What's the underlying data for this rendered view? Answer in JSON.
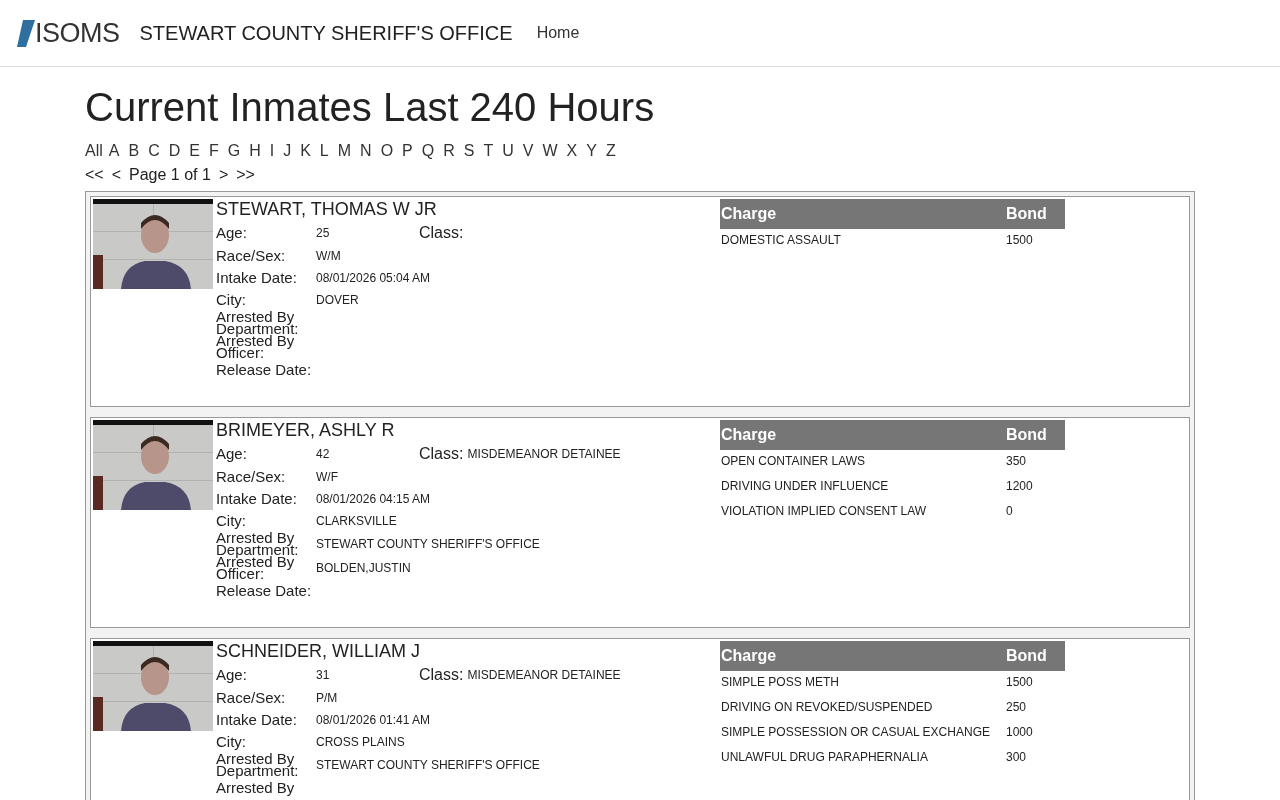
{
  "navbar": {
    "brand": "ISOMS",
    "title": "STEWART COUNTY SHERIFF'S OFFICE",
    "links": [
      "Home"
    ]
  },
  "heading": "Current Inmates Last 240 Hours",
  "letters": [
    "All",
    "A",
    "B",
    "C",
    "D",
    "E",
    "F",
    "G",
    "H",
    "I",
    "J",
    "K",
    "L",
    "M",
    "N",
    "O",
    "P",
    "Q",
    "R",
    "S",
    "T",
    "U",
    "V",
    "W",
    "X",
    "Y",
    "Z"
  ],
  "pager": {
    "first": "<<",
    "prev": "<",
    "label": "Page 1 of 1",
    "next": ">",
    "last": ">>"
  },
  "inmates": [
    {
      "name": "STEWART, THOMAS W JR",
      "class_label": "Class:",
      "fields": [
        {
          "label": "Age:",
          "value": "25"
        },
        {
          "label": "Race/Sex:",
          "value": "W/M"
        },
        {
          "label": "Intake Date:",
          "value": "08/01/2026 05:04 AM"
        },
        {
          "label": "City:",
          "value": "DOVER"
        },
        {
          "label": "Arrested By Department:"
        },
        {
          "label": "Arrested By Officer:"
        },
        {
          "label": "Release Date:"
        }
      ],
      "charge_columns": [
        "Charge",
        "Bond"
      ],
      "charges": [
        {
          "charge": "DOMESTIC ASSAULT",
          "bond": "1500"
        }
      ]
    },
    {
      "name": "BRIMEYER, ASHLY R",
      "class_label": "Class:",
      "class_value": "MISDEMEANOR DETAINEE",
      "fields": [
        {
          "label": "Age:",
          "value": "42"
        },
        {
          "label": "Race/Sex:",
          "value": "W/F"
        },
        {
          "label": "Intake Date:",
          "value": "08/01/2026 04:15 AM"
        },
        {
          "label": "City:",
          "value": "CLARKSVILLE"
        },
        {
          "label": "Arrested By Department:",
          "value": "STEWART COUNTY SHERIFF'S OFFICE"
        },
        {
          "label": "Arrested By Officer:",
          "value": "BOLDEN,JUSTIN"
        },
        {
          "label": "Release Date:"
        }
      ],
      "charge_columns": [
        "Charge",
        "Bond"
      ],
      "charges": [
        {
          "charge": "OPEN CONTAINER LAWS",
          "bond": "350"
        },
        {
          "charge": "DRIVING UNDER INFLUENCE",
          "bond": "1200"
        },
        {
          "charge": "VIOLATION IMPLIED CONSENT LAW",
          "bond": "0"
        }
      ]
    },
    {
      "name": "SCHNEIDER, WILLIAM J",
      "class_label": "Class:",
      "class_value": "MISDEMEANOR DETAINEE",
      "fields": [
        {
          "label": "Age:",
          "value": "31"
        },
        {
          "label": "Race/Sex:",
          "value": "P/M"
        },
        {
          "label": "Intake Date:",
          "value": "08/01/2026 01:41 AM"
        },
        {
          "label": "City:",
          "value": "CROSS PLAINS"
        },
        {
          "label": "Arrested By Department:",
          "value": "STEWART COUNTY SHERIFF'S OFFICE"
        },
        {
          "label": "Arrested By"
        }
      ],
      "charge_columns": [
        "Charge",
        "Bond"
      ],
      "charges": [
        {
          "charge": "SIMPLE POSS METH",
          "bond": "1500"
        },
        {
          "charge": "DRIVING ON REVOKED/SUSPENDED",
          "bond": "250"
        },
        {
          "charge": "SIMPLE POSSESSION OR CASUAL EXCHANGE",
          "bond": "1000"
        },
        {
          "charge": "UNLAWFUL DRUG PARAPHERNALIA",
          "bond": "300"
        }
      ]
    }
  ]
}
